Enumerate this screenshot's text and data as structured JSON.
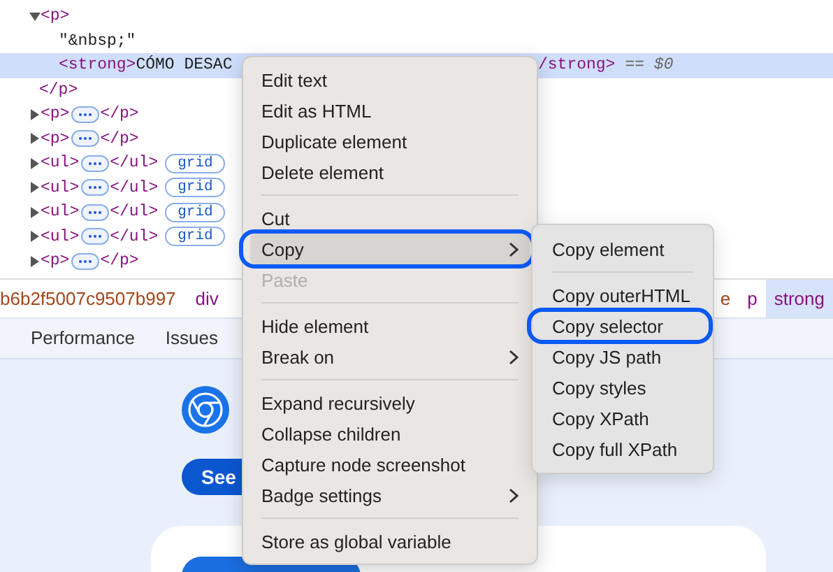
{
  "dom_tree": [
    {
      "kind": "element",
      "open_tag": "<p>",
      "close_tag": "</p>",
      "expanded": true,
      "selected": false,
      "children": [
        {
          "kind": "text",
          "text": "\"&nbsp;\"",
          "selected": false
        },
        {
          "kind": "element",
          "open_tag": "<strong>",
          "content": "CÓMO DESAC",
          "tail": "/strong>",
          "marker": "== $0",
          "selected": true
        }
      ]
    },
    {
      "kind": "element",
      "open_tag": "<p>",
      "close_tag": "</p>",
      "expanded": false,
      "selected": false
    },
    {
      "kind": "element",
      "open_tag": "<p>",
      "close_tag": "</p>",
      "expanded": false,
      "selected": false
    },
    {
      "kind": "element",
      "open_tag": "<ul>",
      "close_tag": "</ul>",
      "badge": "grid",
      "expanded": false,
      "selected": false
    },
    {
      "kind": "element",
      "open_tag": "<ul>",
      "close_tag": "</ul>",
      "badge": "grid",
      "expanded": false,
      "selected": false
    },
    {
      "kind": "element",
      "open_tag": "<ul>",
      "close_tag": "</ul>",
      "badge": "grid",
      "expanded": false,
      "selected": false
    },
    {
      "kind": "element",
      "open_tag": "<ul>",
      "close_tag": "</ul>",
      "badge": "grid",
      "expanded": false,
      "selected": false
    },
    {
      "kind": "element",
      "open_tag": "<p>",
      "close_tag": "</p>",
      "expanded": false,
      "selected": false
    }
  ],
  "breadcrumbs": {
    "before_menu": [
      {
        "text": "b6b2f5007c9507b997",
        "kind": "class",
        "selected": false
      },
      {
        "text": "div",
        "kind": "tag",
        "selected": false
      }
    ],
    "after_menu": [
      {
        "text": "e",
        "kind": "class",
        "selected": false
      },
      {
        "text": "p",
        "kind": "tag",
        "selected": false
      },
      {
        "text": "strong",
        "kind": "tag",
        "selected": true
      }
    ]
  },
  "tabs": [
    {
      "label": "Performance",
      "selected": false
    },
    {
      "label": "Issues",
      "selected": false
    }
  ],
  "page": {
    "button": "See"
  },
  "context_menu": {
    "items": [
      {
        "kind": "item",
        "label": "Edit text",
        "selected": false,
        "disabled": false,
        "submenu": false,
        "annotated": false
      },
      {
        "kind": "item",
        "label": "Edit as HTML",
        "selected": false,
        "disabled": false,
        "submenu": false,
        "annotated": false
      },
      {
        "kind": "item",
        "label": "Duplicate element",
        "selected": false,
        "disabled": false,
        "submenu": false,
        "annotated": false
      },
      {
        "kind": "item",
        "label": "Delete element",
        "selected": false,
        "disabled": false,
        "submenu": false,
        "annotated": false
      },
      {
        "kind": "separator"
      },
      {
        "kind": "item",
        "label": "Cut",
        "selected": false,
        "disabled": false,
        "submenu": false,
        "annotated": false
      },
      {
        "kind": "item",
        "label": "Copy",
        "selected": true,
        "disabled": false,
        "submenu": true,
        "annotated": true
      },
      {
        "kind": "item",
        "label": "Paste",
        "selected": false,
        "disabled": true,
        "submenu": false,
        "annotated": false
      },
      {
        "kind": "separator"
      },
      {
        "kind": "item",
        "label": "Hide element",
        "selected": false,
        "disabled": false,
        "submenu": false,
        "annotated": false
      },
      {
        "kind": "item",
        "label": "Break on",
        "selected": false,
        "disabled": false,
        "submenu": true,
        "annotated": false
      },
      {
        "kind": "separator"
      },
      {
        "kind": "item",
        "label": "Expand recursively",
        "selected": false,
        "disabled": false,
        "submenu": false,
        "annotated": false
      },
      {
        "kind": "item",
        "label": "Collapse children",
        "selected": false,
        "disabled": false,
        "submenu": false,
        "annotated": false
      },
      {
        "kind": "item",
        "label": "Capture node screenshot",
        "selected": false,
        "disabled": false,
        "submenu": false,
        "annotated": false
      },
      {
        "kind": "item",
        "label": "Badge settings",
        "selected": false,
        "disabled": false,
        "submenu": true,
        "annotated": false
      },
      {
        "kind": "separator"
      },
      {
        "kind": "item",
        "label": "Store as global variable",
        "selected": false,
        "disabled": false,
        "submenu": false,
        "annotated": false
      }
    ]
  },
  "submenu": {
    "items": [
      {
        "kind": "item",
        "label": "Copy element",
        "annotated": false
      },
      {
        "kind": "separator"
      },
      {
        "kind": "item",
        "label": "Copy outerHTML",
        "annotated": false
      },
      {
        "kind": "item",
        "label": "Copy selector",
        "annotated": true
      },
      {
        "kind": "item",
        "label": "Copy JS path",
        "annotated": false
      },
      {
        "kind": "item",
        "label": "Copy styles",
        "annotated": false
      },
      {
        "kind": "item",
        "label": "Copy XPath",
        "annotated": false
      },
      {
        "kind": "item",
        "label": "Copy full XPath",
        "annotated": false
      }
    ]
  }
}
